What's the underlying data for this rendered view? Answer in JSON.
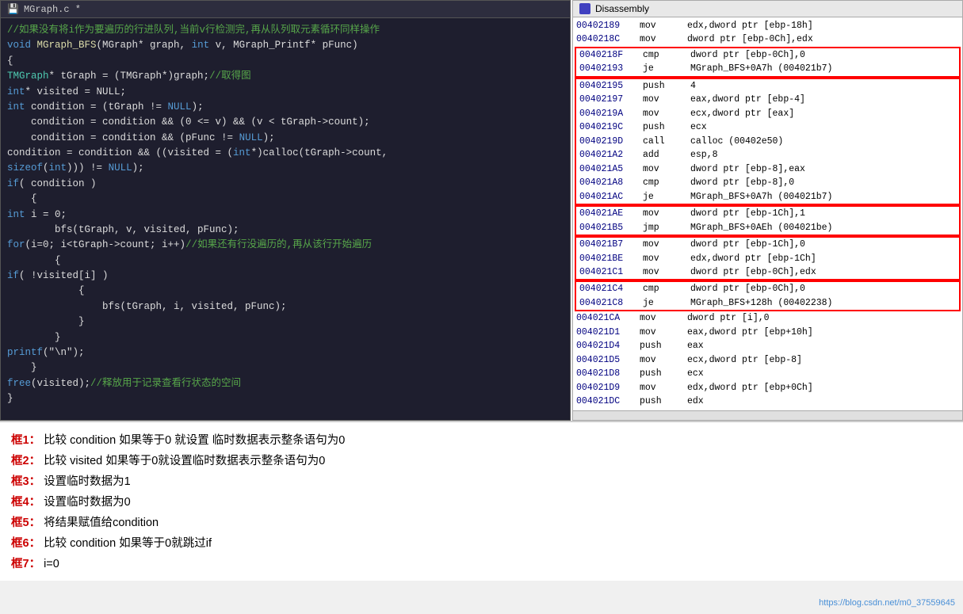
{
  "editor": {
    "title": "MGraph.c *",
    "icon": "💾",
    "lines": [
      {
        "indent": 0,
        "type": "comment",
        "text": "//如果没有将i作为要遍历的行进队列,当前v行检测完,再从队列取元素循环同样操作"
      },
      {
        "indent": 0,
        "type": "mixed",
        "parts": [
          {
            "t": "keyword",
            "v": "void "
          },
          {
            "t": "func",
            "v": "MGraph_BFS"
          },
          {
            "t": "plain",
            "v": "(MGraph* graph, "
          },
          {
            "t": "keyword",
            "v": "int"
          },
          {
            "t": "plain",
            "v": " v, MGraph_Printf* pFunc)"
          }
        ]
      },
      {
        "indent": 0,
        "type": "plain",
        "text": "{"
      },
      {
        "indent": 1,
        "type": "mixed",
        "parts": [
          {
            "t": "type",
            "v": "TMGraph"
          },
          {
            "t": "plain",
            "v": "* tGraph = (TMGraph*)graph;"
          },
          {
            "t": "comment",
            "v": "//取得图"
          }
        ]
      },
      {
        "indent": 1,
        "type": "mixed",
        "parts": [
          {
            "t": "keyword",
            "v": "int"
          },
          {
            "t": "plain",
            "v": "* visited = NULL;"
          }
        ]
      },
      {
        "indent": 1,
        "type": "plain",
        "text": "int condition = (tGraph != NULL);"
      },
      {
        "indent": 0,
        "type": "plain",
        "text": ""
      },
      {
        "indent": 1,
        "type": "plain",
        "text": "condition = condition && (0 <= v) && (v < tGraph->count);"
      },
      {
        "indent": 1,
        "type": "plain",
        "text": "condition = condition && (pFunc != NULL);"
      },
      {
        "indent": 1,
        "type": "mixed",
        "parts": [
          {
            "t": "plain",
            "v": "condition = condition && ((visited = ("
          },
          {
            "t": "keyword",
            "v": "int"
          },
          {
            "t": "plain",
            "v": "*)calloc(tGraph->count,"
          }
        ]
      },
      {
        "indent": 2,
        "type": "plain",
        "text": "sizeof(int))) != NULL);"
      },
      {
        "indent": 1,
        "type": "mixed",
        "parts": [
          {
            "t": "keyword",
            "v": "if"
          },
          {
            "t": "plain",
            "v": "( condition )"
          }
        ]
      },
      {
        "indent": 1,
        "type": "plain",
        "text": "{"
      },
      {
        "indent": 2,
        "type": "mixed",
        "parts": [
          {
            "t": "keyword",
            "v": "int"
          },
          {
            "t": "plain",
            "v": " i = 0;"
          }
        ]
      },
      {
        "indent": 0,
        "type": "plain",
        "text": ""
      },
      {
        "indent": 2,
        "type": "plain",
        "text": "bfs(tGraph, v, visited, pFunc);"
      },
      {
        "indent": 0,
        "type": "plain",
        "text": ""
      },
      {
        "indent": 2,
        "type": "mixed",
        "parts": [
          {
            "t": "keyword",
            "v": "for"
          },
          {
            "t": "plain",
            "v": "(i=0; i<tGraph->count; i++)"
          },
          {
            "t": "comment",
            "v": "//如果还有行没遍历的,再从该行开始遍历"
          }
        ]
      },
      {
        "indent": 2,
        "type": "plain",
        "text": "{"
      },
      {
        "indent": 3,
        "type": "mixed",
        "parts": [
          {
            "t": "keyword",
            "v": "if"
          },
          {
            "t": "plain",
            "v": "( !visited[i] )"
          }
        ]
      },
      {
        "indent": 3,
        "type": "plain",
        "text": "{"
      },
      {
        "indent": 4,
        "type": "plain",
        "text": "bfs(tGraph, i, visited, pFunc);"
      },
      {
        "indent": 3,
        "type": "plain",
        "text": "}"
      },
      {
        "indent": 2,
        "type": "plain",
        "text": "}"
      },
      {
        "indent": 2,
        "type": "plain",
        "text": "printf(\"\\n\");"
      },
      {
        "indent": 1,
        "type": "plain",
        "text": "}"
      },
      {
        "indent": 0,
        "type": "mixed",
        "parts": [
          {
            "t": "keyword",
            "v": "free"
          },
          {
            "t": "plain",
            "v": "(visited);"
          },
          {
            "t": "comment",
            "v": "//释放用于记录查看行状态的空间"
          }
        ]
      },
      {
        "indent": 0,
        "type": "plain",
        "text": "}"
      }
    ]
  },
  "disasm": {
    "title": "Disassembly",
    "rows": [
      {
        "addr": "00402189",
        "mn": "mov",
        "op": "edx,dword ptr [ebp-18h]",
        "box": false,
        "highlighted": false
      },
      {
        "addr": "0040218C",
        "mn": "mov",
        "op": "dword ptr [ebp-0Ch],edx",
        "box": false,
        "highlighted": false
      },
      {
        "addr": "0040218F",
        "mn": "cmp",
        "op": "dword ptr [ebp-0Ch],0",
        "box": true,
        "box_start": true,
        "highlighted": false
      },
      {
        "addr": "00402193",
        "mn": "je",
        "op": "MGraph_BFS+0A7h (004021b7)",
        "box": true,
        "box_end": true,
        "highlighted": false
      },
      {
        "addr": "00402195",
        "mn": "push",
        "op": "4",
        "box": true,
        "box_start": true,
        "highlighted": false
      },
      {
        "addr": "00402197",
        "mn": "mov",
        "op": "eax,dword ptr [ebp-4]",
        "box": true,
        "highlighted": false
      },
      {
        "addr": "0040219A",
        "mn": "mov",
        "op": "ecx,dword ptr [eax]",
        "box": true,
        "highlighted": false
      },
      {
        "addr": "0040219C",
        "mn": "push",
        "op": "ecx",
        "box": true,
        "highlighted": false
      },
      {
        "addr": "0040219D",
        "mn": "call",
        "op": "calloc (00402e50)",
        "box": true,
        "highlighted": false
      },
      {
        "addr": "004021A2",
        "mn": "add",
        "op": "esp,8",
        "box": true,
        "highlighted": false
      },
      {
        "addr": "004021A5",
        "mn": "mov",
        "op": "dword ptr [ebp-8],eax",
        "box": true,
        "highlighted": false
      },
      {
        "addr": "004021A8",
        "mn": "cmp",
        "op": "dword ptr [ebp-8],0",
        "box": true,
        "highlighted": false
      },
      {
        "addr": "004021AC",
        "mn": "je",
        "op": "MGraph_BFS+0A7h (004021b7)",
        "box": true,
        "box_end": true,
        "highlighted": false
      },
      {
        "addr": "004021AE",
        "mn": "mov",
        "op": "dword ptr [ebp-1Ch],1",
        "box": true,
        "box_start": true,
        "highlighted": false
      },
      {
        "addr": "004021B5",
        "mn": "jmp",
        "op": "MGraph_BFS+0AEh (004021be)",
        "box": true,
        "box_end": true,
        "highlighted": false
      },
      {
        "addr": "004021B7",
        "mn": "mov",
        "op": "dword ptr [ebp-1Ch],0",
        "highlighted": false,
        "box": true,
        "box_start": true
      },
      {
        "addr": "004021BE",
        "mn": "mov",
        "op": "edx,dword ptr [ebp-1Ch]",
        "box": true,
        "highlighted": false
      },
      {
        "addr": "004021C1",
        "mn": "mov",
        "op": "dword ptr [ebp-0Ch],edx",
        "box": true,
        "box_end": true,
        "highlighted": false
      },
      {
        "addr": "004021C4",
        "mn": "cmp",
        "op": "dword ptr [ebp-0Ch],0",
        "box": true,
        "box_start": true,
        "highlighted": false
      },
      {
        "addr": "004021C8",
        "mn": "je",
        "op": "MGraph_BFS+128h (00402238)",
        "box": true,
        "box_end": true,
        "highlighted": false
      },
      {
        "addr": "004021CA",
        "mn": "mov",
        "op": "dword ptr [i],0",
        "box": false,
        "highlighted": false
      },
      {
        "addr": "004021D1",
        "mn": "mov",
        "op": "eax,dword ptr [ebp+10h]",
        "box": false,
        "highlighted": false
      },
      {
        "addr": "004021D4",
        "mn": "push",
        "op": "eax",
        "box": false,
        "highlighted": false
      },
      {
        "addr": "004021D5",
        "mn": "mov",
        "op": "ecx,dword ptr [ebp-8]",
        "box": false,
        "highlighted": false
      },
      {
        "addr": "004021D8",
        "mn": "push",
        "op": "ecx",
        "box": false,
        "highlighted": false
      },
      {
        "addr": "004021D9",
        "mn": "mov",
        "op": "edx,dword ptr [ebp+0Ch]",
        "box": false,
        "highlighted": false
      },
      {
        "addr": "004021DC",
        "mn": "push",
        "op": "edx",
        "box": false,
        "highlighted": false
      }
    ]
  },
  "labels": [
    {
      "num": "框1：",
      "text": "比较 condition 如果等于0 就设置 临时数据表示整条语句为0"
    },
    {
      "num": "框2：",
      "text": "比较 visited 如果等于0就设置临时数据表示整条语句为0"
    },
    {
      "num": "框3：",
      "text": "设置临时数据为1"
    },
    {
      "num": "框4：",
      "text": "设置临时数据为0"
    },
    {
      "num": "框5：",
      "text": "将结果赋值给condition"
    },
    {
      "num": "框6：",
      "text": "比较 condition 如果等于0就跳过if"
    },
    {
      "num": "框7：",
      "text": "i=0"
    }
  ],
  "watermark": "https://blog.csdn.net/m0_37559645"
}
